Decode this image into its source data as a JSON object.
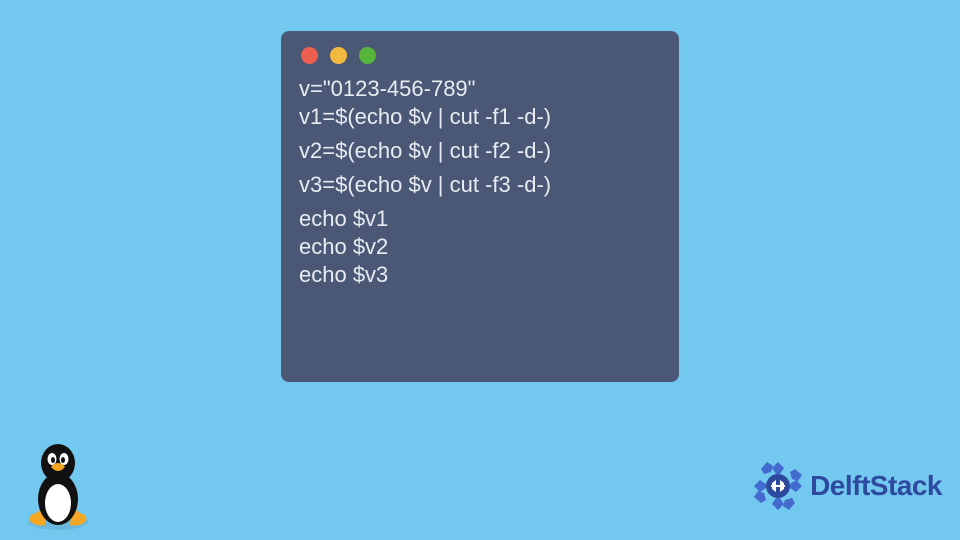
{
  "code": {
    "lines": [
      "v=\"0123-456-789\"",
      "v1=$(echo $v | cut -f1 -d-)",
      "v2=$(echo $v | cut -f2 -d-)",
      "v3=$(echo $v | cut -f3 -d-)",
      "echo $v1",
      "echo $v2",
      "echo $v3"
    ]
  },
  "brand": {
    "name": "DelftStack"
  },
  "colors": {
    "background": "#73c8f0",
    "window": "#4a5775",
    "text": "#e8ecf2",
    "brand": "#2d4a9e"
  }
}
